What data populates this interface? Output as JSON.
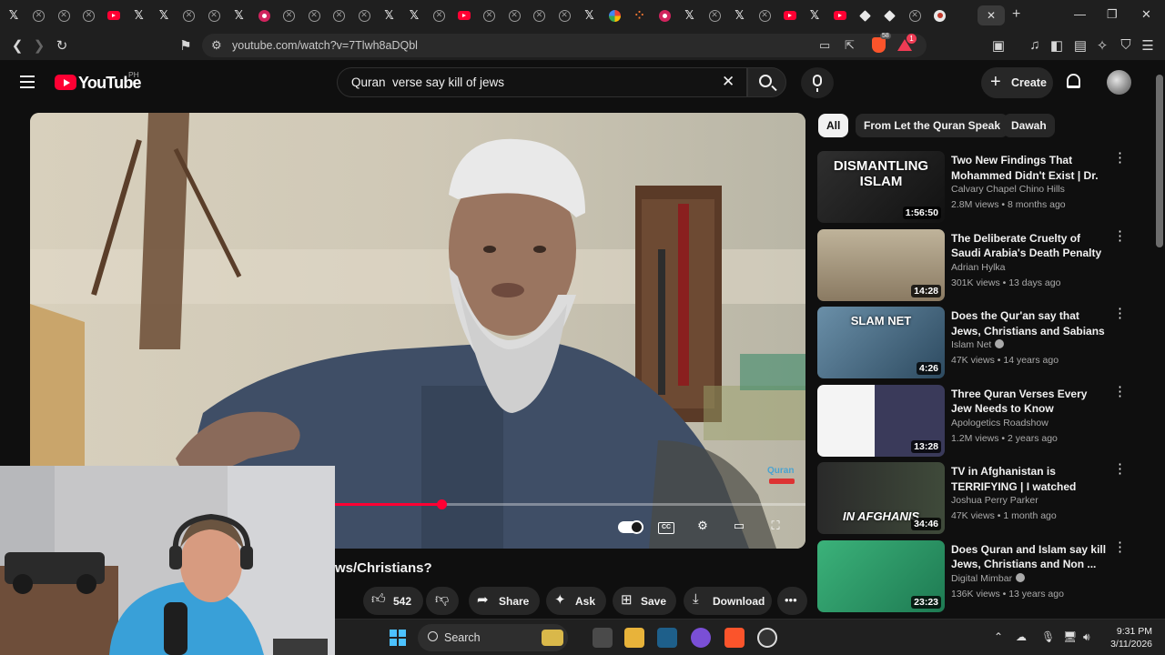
{
  "browser": {
    "url": "youtube.com/watch?v=7Tlwh8aDQbl",
    "brave_badge": "58",
    "rewards_badge": "1",
    "tabs": [
      "x",
      "xc",
      "xc",
      "xc",
      "yt",
      "x",
      "x",
      "xc",
      "xc",
      "x",
      "pk",
      "xc",
      "xc",
      "xc",
      "xc",
      "x",
      "x",
      "xc",
      "yt",
      "xc",
      "xc",
      "xc",
      "xc",
      "x",
      "gg",
      "dots",
      "pk",
      "x",
      "xc",
      "x",
      "xc",
      "yt",
      "x",
      "yt",
      "dia",
      "dia",
      "xc",
      "rd"
    ]
  },
  "header": {
    "logo": "YouTube",
    "region": "PH",
    "search_query": "Quran  verse say kill of jews",
    "create_label": "Create"
  },
  "player": {
    "progress": 0.53,
    "buffered": 0.57,
    "watermark": "Quran"
  },
  "video": {
    "title_visible": "ws/Christians?",
    "likes": "542",
    "share_label": "Share",
    "ask_label": "Ask",
    "save_label": "Save",
    "download_label": "Download"
  },
  "chips": [
    "All",
    "From Let the Quran Speak",
    "Dawah"
  ],
  "recommendations": [
    {
      "title": "Two New Findings That Mohammed Didn't Exist | Dr. J...",
      "channel": "Calvary Chapel Chino Hills",
      "meta": "2.8M views • 8 months ago",
      "duration": "1:56:50",
      "verified": false,
      "thumb_text": "DISMANTLING ISLAM"
    },
    {
      "title": "The Deliberate Cruelty of Saudi Arabia's Death Penalty",
      "channel": "Adrian Hylka",
      "meta": "301K views • 13 days ago",
      "duration": "14:28",
      "verified": false,
      "thumb_text": ""
    },
    {
      "title": "Does the Qur'an say that Jews, Christians and Sabians will be ...",
      "channel": "Islam Net",
      "meta": "47K views • 14 years ago",
      "duration": "4:26",
      "verified": true,
      "thumb_text": "SLAM NET"
    },
    {
      "title": "Three Quran Verses Every Jew Needs to Know",
      "channel": "Apologetics Roadshow",
      "meta": "1.2M views • 2 years ago",
      "duration": "13:28",
      "verified": false,
      "thumb_text": ""
    },
    {
      "title": "TV in Afghanistan is TERRIFYING | I watched Afgha...",
      "channel": "Joshua Perry Parker",
      "meta": "47K views • 1 month ago",
      "duration": "34:46",
      "verified": false,
      "thumb_text": "IN AFGHANIS"
    },
    {
      "title": "Does Quran and Islam say kill Jews, Christians and Non ...",
      "channel": "Digital Mimbar",
      "meta": "136K views • 13 years ago",
      "duration": "23:23",
      "verified": true,
      "thumb_text": ""
    }
  ],
  "taskbar": {
    "search_label": "Search",
    "time": "9:31 PM",
    "date": "3/11/2026"
  },
  "colors": {
    "accent": "#ff0033",
    "bg": "#0f0f0f",
    "chip_bg": "#272727"
  }
}
